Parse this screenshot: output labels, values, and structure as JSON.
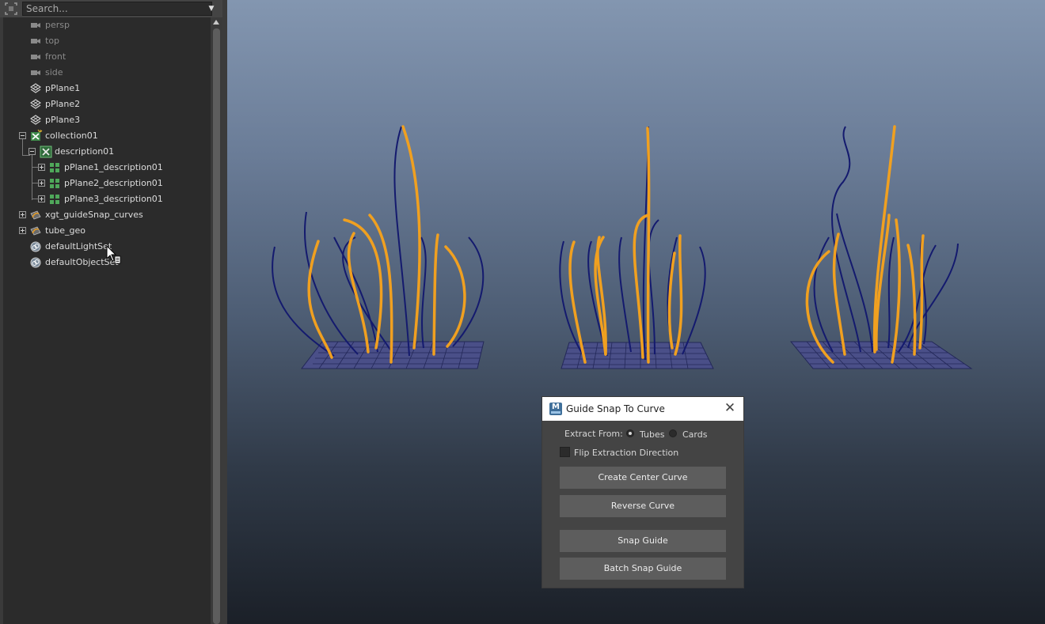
{
  "outliner": {
    "search": {
      "placeholder": "Search..."
    },
    "items": [
      {
        "label": "persp",
        "icon": "camera-icon",
        "dim": true
      },
      {
        "label": "top",
        "icon": "camera-icon",
        "dim": true
      },
      {
        "label": "front",
        "icon": "camera-icon",
        "dim": true
      },
      {
        "label": "side",
        "icon": "camera-icon",
        "dim": true
      },
      {
        "label": "pPlane1",
        "icon": "mesh-icon"
      },
      {
        "label": "pPlane2",
        "icon": "mesh-icon"
      },
      {
        "label": "pPlane3",
        "icon": "mesh-icon"
      },
      {
        "label": "collection01",
        "icon": "xgen-collection-icon",
        "expanded": true
      },
      {
        "label": "description01",
        "icon": "xgen-description-icon",
        "expanded": true
      },
      {
        "label": "pPlane1_description01",
        "icon": "xgen-patch-icon"
      },
      {
        "label": "pPlane2_description01",
        "icon": "xgen-patch-icon"
      },
      {
        "label": "pPlane3_description01",
        "icon": "xgen-patch-icon"
      },
      {
        "label": "xgt_guideSnap_curves",
        "icon": "curve-group-icon"
      },
      {
        "label": "tube_geo",
        "icon": "curve-group-icon"
      },
      {
        "label": "defaultLightSet",
        "icon": "set-icon"
      },
      {
        "label": "defaultObjectSet",
        "icon": "set-icon"
      }
    ]
  },
  "dialog": {
    "title": "Guide Snap To Curve",
    "app_icon_letter": "M",
    "extract_from_label": "Extract From:",
    "radio_tubes": "Tubes",
    "radio_cards": "Cards",
    "selected_source": "Tubes",
    "flip_label": "Flip Extraction Direction",
    "flip_checked": false,
    "buttons": {
      "create_center_curve": "Create Center Curve",
      "reverse_curve": "Reverse Curve",
      "snap_guide": "Snap Guide",
      "batch_snap_guide": "Batch Snap Guide"
    }
  },
  "colors": {
    "guide_curve": "#f0a020",
    "hair_curve": "#141a6e",
    "grid": "#2a2f6a"
  }
}
